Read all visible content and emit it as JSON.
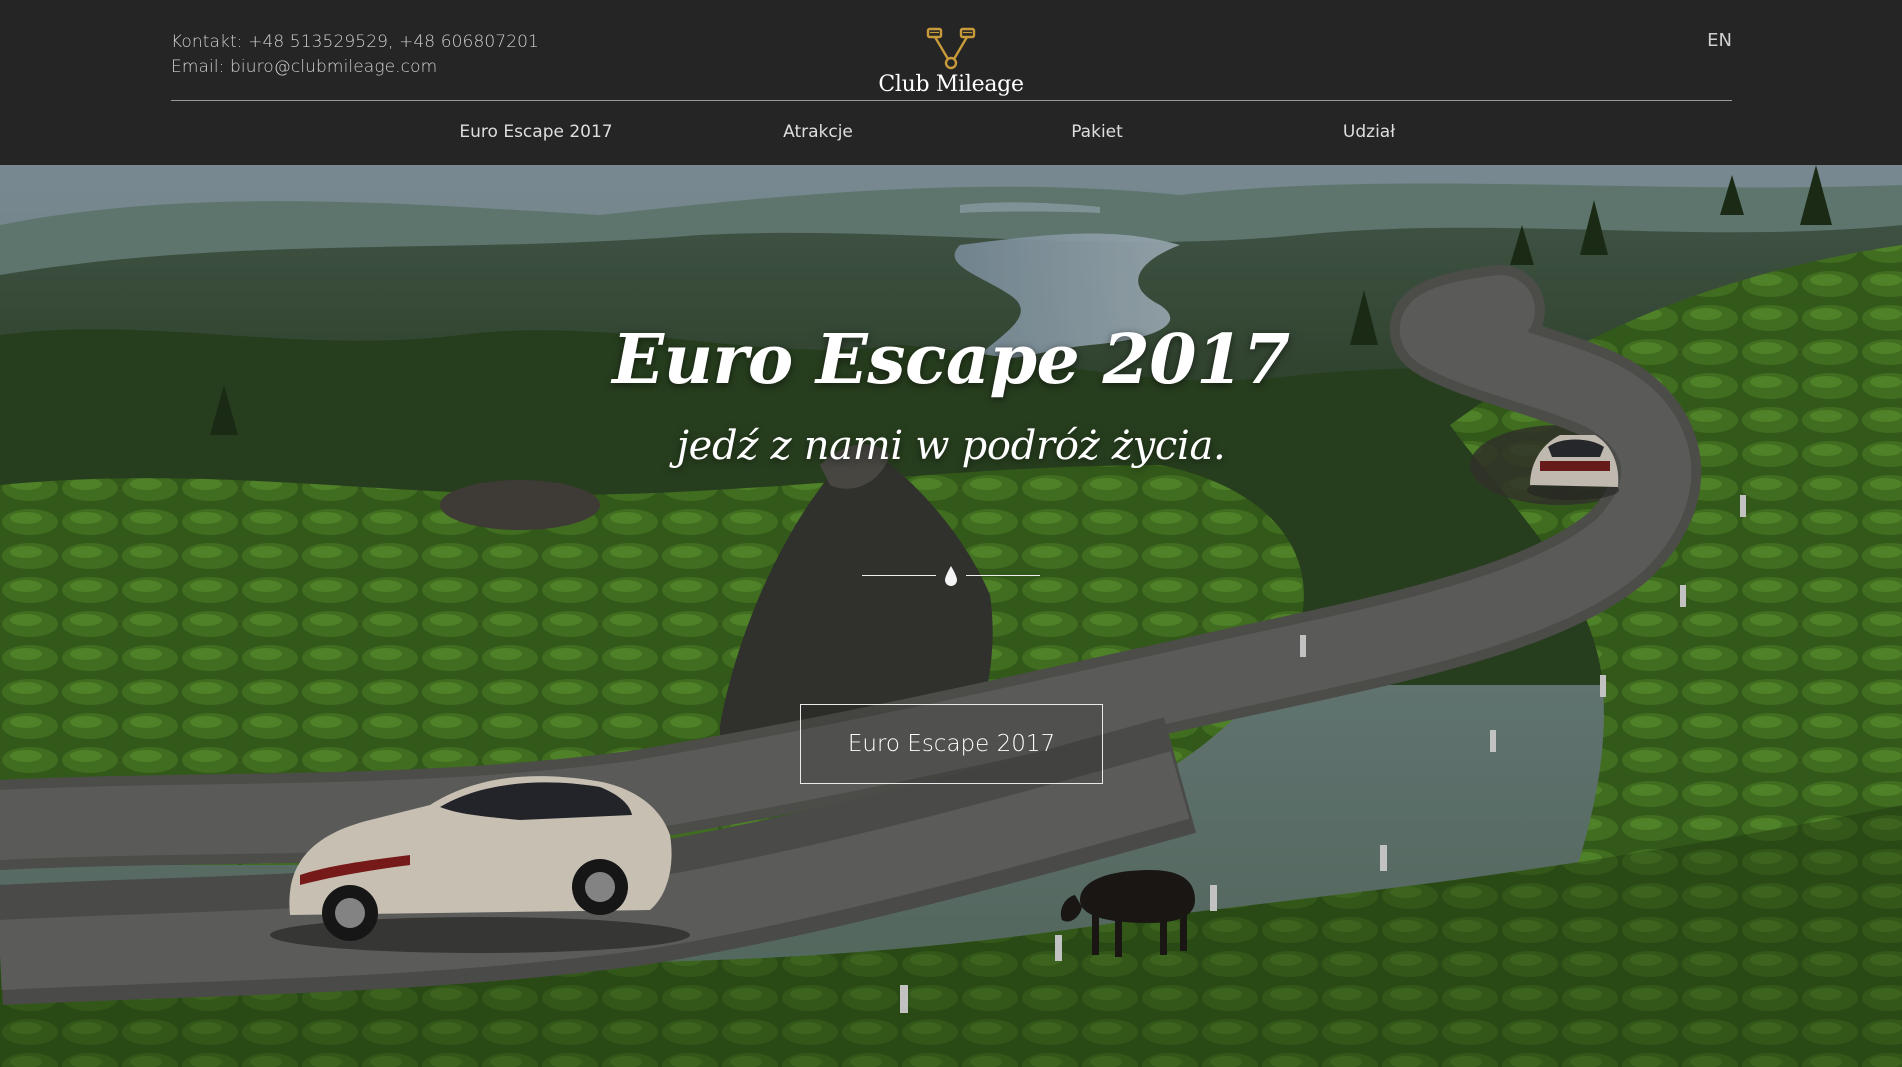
{
  "header": {
    "contact_phone": "Kontakt: +48 513529529, +48 606807201",
    "contact_email": "Email: biuro@clubmileage.com",
    "logo_text": "Club Mileage",
    "language": "EN"
  },
  "nav": {
    "items": [
      {
        "label": "Euro Escape 2017"
      },
      {
        "label": "Atrakcje"
      },
      {
        "label": "Pakiet"
      },
      {
        "label": "Udział"
      }
    ]
  },
  "hero": {
    "title": "Euro Escape 2017",
    "subtitle": "jedź z nami w podróż życia.",
    "button_label": "Euro Escape 2017",
    "background_icon": "mountain-road-photo-icon"
  },
  "colors": {
    "header_bg": "#252525",
    "logo_gold": "#c89a3a",
    "hero_text": "#ffffff"
  }
}
